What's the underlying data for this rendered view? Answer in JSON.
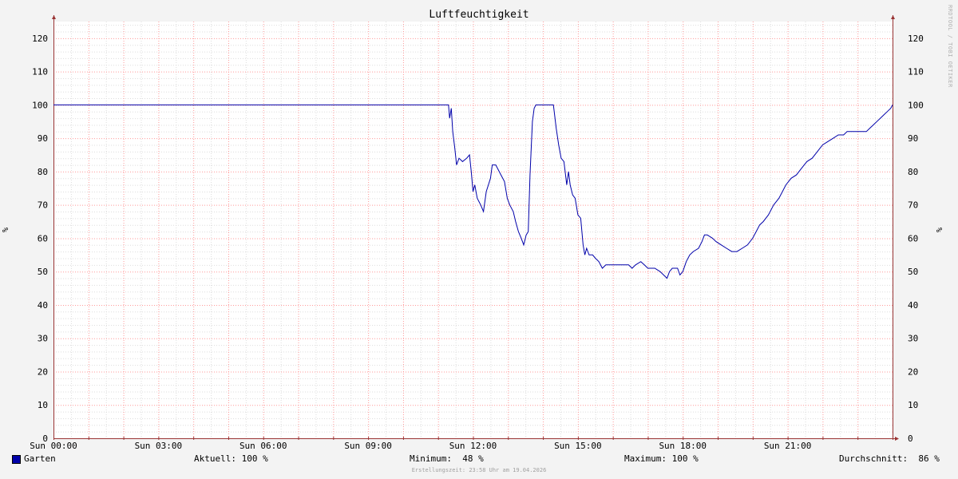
{
  "chart_data": {
    "type": "line",
    "title": "Luftfeuchtigkeit",
    "ylabel": "%",
    "ylabel_right": "%",
    "ylim": [
      0,
      125
    ],
    "y_ticks": [
      0,
      10,
      20,
      30,
      40,
      50,
      60,
      70,
      80,
      90,
      100,
      110,
      120
    ],
    "x_tick_labels": [
      "Sun 00:00",
      "Sun 03:00",
      "Sun 06:00",
      "Sun 09:00",
      "Sun 12:00",
      "Sun 15:00",
      "Sun 18:00",
      "Sun 21:00"
    ],
    "x_tick_hours": [
      0,
      3,
      6,
      9,
      12,
      15,
      18,
      21
    ],
    "xlim_hours": [
      0,
      24
    ],
    "grid": true,
    "colors": {
      "series": "#0000aa",
      "major_grid": "#ff9999",
      "minor_grid": "#dddddd",
      "axis": "#993333",
      "background": "#ffffff",
      "canvas": "#f3f3f3"
    },
    "series": [
      {
        "name": "Garten",
        "points": [
          [
            0,
            100
          ],
          [
            11.3,
            100
          ],
          [
            11.33,
            96
          ],
          [
            11.38,
            99
          ],
          [
            11.42,
            92
          ],
          [
            11.48,
            87
          ],
          [
            11.53,
            82
          ],
          [
            11.6,
            84
          ],
          [
            11.7,
            83
          ],
          [
            11.82,
            84
          ],
          [
            11.9,
            85
          ],
          [
            11.95,
            80
          ],
          [
            12.0,
            74
          ],
          [
            12.05,
            76
          ],
          [
            12.12,
            72
          ],
          [
            12.22,
            70
          ],
          [
            12.3,
            68
          ],
          [
            12.38,
            74
          ],
          [
            12.5,
            78
          ],
          [
            12.55,
            82
          ],
          [
            12.65,
            82
          ],
          [
            12.8,
            79
          ],
          [
            12.9,
            77
          ],
          [
            12.98,
            72
          ],
          [
            13.05,
            70
          ],
          [
            13.15,
            68
          ],
          [
            13.22,
            65
          ],
          [
            13.3,
            62
          ],
          [
            13.38,
            60
          ],
          [
            13.45,
            58
          ],
          [
            13.52,
            61
          ],
          [
            13.58,
            62
          ],
          [
            13.63,
            79
          ],
          [
            13.7,
            95
          ],
          [
            13.75,
            99
          ],
          [
            13.8,
            100
          ],
          [
            14.2,
            100
          ],
          [
            14.3,
            100
          ],
          [
            14.38,
            93
          ],
          [
            14.45,
            88
          ],
          [
            14.52,
            84
          ],
          [
            14.6,
            83
          ],
          [
            14.68,
            76
          ],
          [
            14.73,
            80
          ],
          [
            14.78,
            76
          ],
          [
            14.85,
            73
          ],
          [
            14.92,
            72
          ],
          [
            15.0,
            67
          ],
          [
            15.08,
            66
          ],
          [
            15.15,
            58
          ],
          [
            15.2,
            55
          ],
          [
            15.25,
            57
          ],
          [
            15.32,
            55
          ],
          [
            15.42,
            55
          ],
          [
            15.5,
            54
          ],
          [
            15.6,
            53
          ],
          [
            15.7,
            51
          ],
          [
            15.8,
            52
          ],
          [
            15.9,
            52
          ],
          [
            16.0,
            52
          ],
          [
            16.2,
            52
          ],
          [
            16.45,
            52
          ],
          [
            16.55,
            51
          ],
          [
            16.65,
            52
          ],
          [
            16.8,
            53
          ],
          [
            16.9,
            52
          ],
          [
            17.0,
            51
          ],
          [
            17.2,
            51
          ],
          [
            17.35,
            50
          ],
          [
            17.45,
            49
          ],
          [
            17.55,
            48
          ],
          [
            17.62,
            50
          ],
          [
            17.7,
            51
          ],
          [
            17.85,
            51
          ],
          [
            17.92,
            49
          ],
          [
            18.0,
            50
          ],
          [
            18.1,
            53
          ],
          [
            18.2,
            55
          ],
          [
            18.3,
            56
          ],
          [
            18.45,
            57
          ],
          [
            18.55,
            59
          ],
          [
            18.62,
            61
          ],
          [
            18.7,
            61
          ],
          [
            18.85,
            60
          ],
          [
            18.95,
            59
          ],
          [
            19.1,
            58
          ],
          [
            19.25,
            57
          ],
          [
            19.4,
            56
          ],
          [
            19.55,
            56
          ],
          [
            19.7,
            57
          ],
          [
            19.85,
            58
          ],
          [
            20.0,
            60
          ],
          [
            20.1,
            62
          ],
          [
            20.2,
            64
          ],
          [
            20.3,
            65
          ],
          [
            20.45,
            67
          ],
          [
            20.6,
            70
          ],
          [
            20.75,
            72
          ],
          [
            20.85,
            74
          ],
          [
            20.95,
            76
          ],
          [
            21.1,
            78
          ],
          [
            21.25,
            79
          ],
          [
            21.4,
            81
          ],
          [
            21.55,
            83
          ],
          [
            21.7,
            84
          ],
          [
            21.85,
            86
          ],
          [
            22.0,
            88
          ],
          [
            22.15,
            89
          ],
          [
            22.3,
            90
          ],
          [
            22.45,
            91
          ],
          [
            22.6,
            91
          ],
          [
            22.7,
            92
          ],
          [
            23.0,
            92
          ],
          [
            23.25,
            92
          ],
          [
            23.35,
            93
          ],
          [
            23.45,
            94
          ],
          [
            23.55,
            95
          ],
          [
            23.65,
            96
          ],
          [
            23.75,
            97
          ],
          [
            23.85,
            98
          ],
          [
            23.95,
            99
          ],
          [
            24.0,
            100
          ]
        ]
      }
    ]
  },
  "legend": {
    "series_name": "Garten",
    "current": "Aktuell: 100 %",
    "minimum": "Minimum:  48 %",
    "maximum": "Maximum: 100 %",
    "average": "Durchschnitt:  86 %"
  },
  "footer": "Erstellungszeit: 23:58 Uhr am 19.04.2026",
  "watermark": "RRDTOOL / TOBI OETIKER"
}
